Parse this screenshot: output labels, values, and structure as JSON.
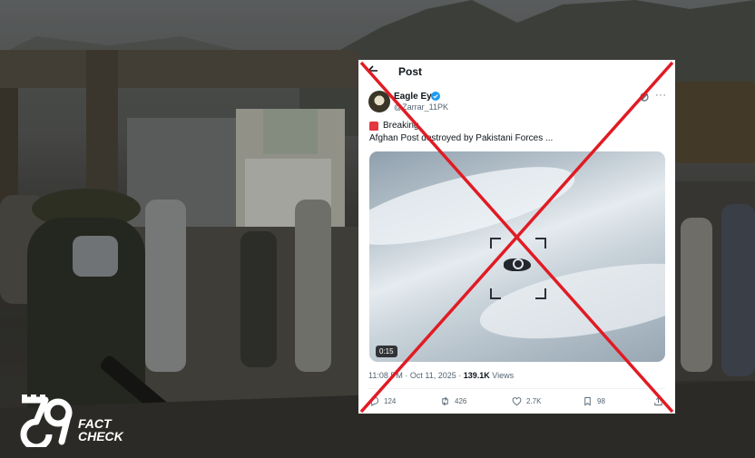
{
  "post": {
    "header_title": "Post",
    "author_name": "Eagle Eye",
    "author_handle": "@Zarrar_11PK",
    "breaking_label": "Breaking",
    "text": "Afghan Post destroyed by Pakistani Forces ...",
    "video_duration": "0:15",
    "timestamp": "11:08 PM · Oct 11, 2025 · ",
    "views_count": "139.1K",
    "views_label": " Views",
    "stats": {
      "replies": "124",
      "reposts": "426",
      "likes": "2.7K",
      "bookmarks": "98"
    }
  },
  "logo": {
    "line1": "FACT",
    "line2": "CHECK"
  },
  "verdict_mark": "red-x-cross",
  "colors": {
    "cross": "#e01b24",
    "verified": "#1d9bf0"
  }
}
